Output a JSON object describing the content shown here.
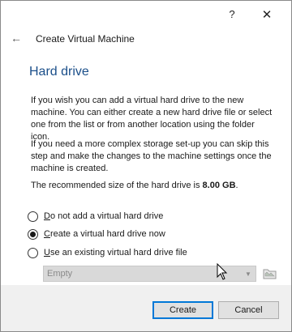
{
  "window": {
    "help_glyph": "?",
    "close_glyph": "✕"
  },
  "header": {
    "back_glyph": "←",
    "title": "Create Virtual Machine"
  },
  "page": {
    "heading": "Hard drive",
    "paragraph1": "If you wish you can add a virtual hard drive to the new machine. You can either create a new hard drive file or select one from the list or from another location using the folder icon.",
    "paragraph2": "If you need a more complex storage set-up you can skip this step and make the changes to the machine settings once the machine is created.",
    "recommended_prefix": "The recommended size of the hard drive is ",
    "recommended_size": "8.00 GB",
    "recommended_suffix": "."
  },
  "options": [
    {
      "mnemonic": "D",
      "rest": "o not add a virtual hard drive",
      "checked": false
    },
    {
      "mnemonic": "C",
      "rest": "reate a virtual hard drive now",
      "checked": true
    },
    {
      "mnemonic": "U",
      "rest": "se an existing virtual hard drive file",
      "checked": false
    }
  ],
  "existing_file": {
    "selected": "Empty",
    "enabled": false
  },
  "buttons": {
    "create": "Create",
    "cancel": "Cancel"
  },
  "colors": {
    "heading": "#1b4f8a",
    "default_button_border": "#0078d7"
  }
}
